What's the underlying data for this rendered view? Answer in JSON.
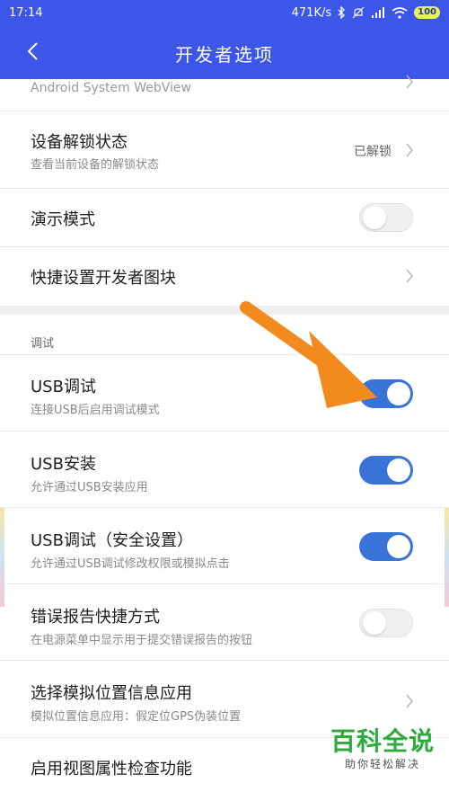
{
  "status_bar": {
    "time": "17:14",
    "net_speed": "471K/s",
    "battery": "100"
  },
  "header": {
    "title": "开发者选项"
  },
  "partial_row": {
    "subtitle": "Android System WebView"
  },
  "rows": {
    "unlock": {
      "title": "设备解锁状态",
      "subtitle": "查看当前设备的解锁状态",
      "value": "已解锁"
    },
    "demo": {
      "title": "演示模式",
      "toggle": "off"
    },
    "quick_tile": {
      "title": "快捷设置开发者图块"
    },
    "usb_debug": {
      "title": "USB调试",
      "subtitle": "连接USB后启用调试模式",
      "toggle": "on"
    },
    "usb_install": {
      "title": "USB安装",
      "subtitle": "允许通过USB安装应用",
      "toggle": "on"
    },
    "usb_secure": {
      "title": "USB调试（安全设置）",
      "subtitle": "允许通过USB调试修改权限或模拟点击",
      "toggle": "on"
    },
    "bug_report": {
      "title": "错误报告快捷方式",
      "subtitle": "在电源菜单中显示用于提交错误报告的按钮",
      "toggle": "off"
    },
    "mock_location": {
      "title": "选择模拟位置信息应用",
      "subtitle": "模拟位置信息应用：假定位GPS伪装位置"
    },
    "view_attr": {
      "title": "启用视图属性检查功能"
    }
  },
  "section": {
    "debug_label": "调试"
  },
  "watermark": {
    "title": "百科全说",
    "subtitle": "助你轻松解决"
  },
  "colors": {
    "header_blue": "#3c56e8",
    "toggle_on": "#3a73d8",
    "arrow_orange": "#f28a1e",
    "watermark_green": "#2eaa3f"
  },
  "icons": [
    "back-arrow-icon",
    "chevron-right-icon",
    "bluetooth-icon",
    "mute-icon",
    "signal-icon",
    "wifi-icon",
    "battery-icon",
    "pointer-arrow-icon"
  ]
}
